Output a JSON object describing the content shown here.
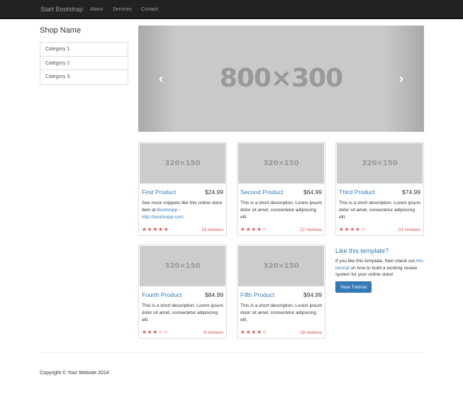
{
  "navbar": {
    "brand": "Start Bootstrap",
    "links": [
      "About",
      "Services",
      "Contact"
    ]
  },
  "sidebar": {
    "shop_name": "Shop Name",
    "categories": [
      "Category 1",
      "Category 2",
      "Category 3"
    ]
  },
  "carousel": {
    "placeholder": "800×300",
    "prev_icon": "chevron-left-icon",
    "next_icon": "chevron-right-icon",
    "indicators": 3,
    "active_indicator": 3
  },
  "products": [
    {
      "image": "320×150",
      "title": "First Product",
      "price": "$24.99",
      "desc_prefix": "See more snippets like this online store item at ",
      "desc_link1": "Bootsnipp",
      "desc_sep": " - ",
      "desc_link2": "http://bootsnipp.com",
      "desc_suffix": ".",
      "stars": "★★★★★",
      "rating": 5,
      "reviews": "15 reviews"
    },
    {
      "image": "320×150",
      "title": "Second Product",
      "price": "$64.99",
      "desc": "This is a short description. Lorem ipsum dolor sit amet, consectetur adipiscing elit.",
      "stars": "★★★★☆",
      "rating": 4,
      "reviews": "12 reviews"
    },
    {
      "image": "320×150",
      "title": "Third Product",
      "price": "$74.99",
      "desc": "This is a short description. Lorem ipsum dolor sit amet, consectetur adipiscing elit.",
      "stars": "★★★★☆",
      "rating": 4,
      "reviews": "31 reviews"
    },
    {
      "image": "320×150",
      "title": "Fourth Product",
      "price": "$84.99",
      "desc": "This is a short description. Lorem ipsum dolor sit amet, consectetur adipiscing elit.",
      "stars": "★★★☆☆",
      "rating": 3,
      "reviews": "6 reviews"
    },
    {
      "image": "320×150",
      "title": "Fifth Product",
      "price": "$94.99",
      "desc": "This is a short description. Lorem ipsum dolor sit amet, consectetur adipiscing elit.",
      "stars": "★★★★☆",
      "rating": 4,
      "reviews": "18 reviews"
    }
  ],
  "promo": {
    "title": "Like this template?",
    "text_prefix": "If you like this template, then check out ",
    "link": "this tutorial",
    "text_suffix": " on how to build a working review system for your online store!",
    "button": "View Tutorial"
  },
  "footer": {
    "copyright": "Copyright © Your Website 2014"
  },
  "colors": {
    "navbar_bg": "#222222",
    "link": "#337ab7",
    "star": "#d9534f",
    "placeholder_bg": "#cccccc"
  }
}
